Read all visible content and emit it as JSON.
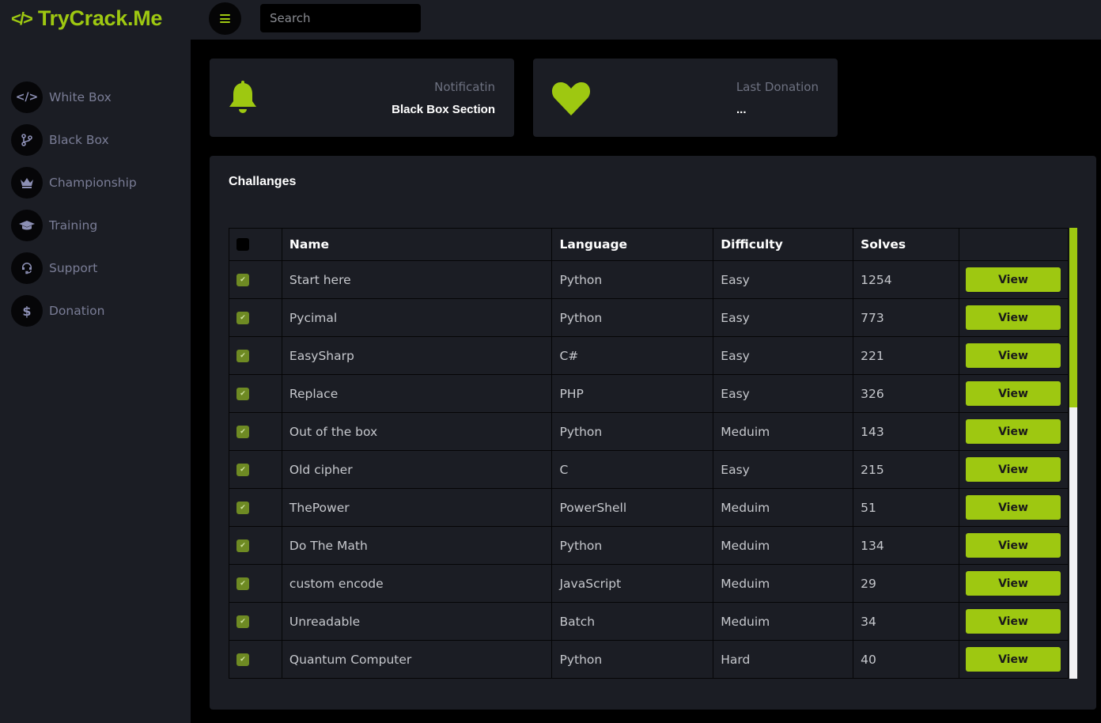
{
  "brand": {
    "name": "TryCrack.Me",
    "icon": "code-icon",
    "accent": "#9ec811"
  },
  "topbar": {
    "menu_icon": "hamburger-icon",
    "search_placeholder": "Search",
    "search_value": ""
  },
  "sidebar": {
    "items": [
      {
        "label": "White Box",
        "icon": "code-icon"
      },
      {
        "label": "Black Box",
        "icon": "code-branch-icon"
      },
      {
        "label": "Championship",
        "icon": "crown-icon"
      },
      {
        "label": "Training",
        "icon": "graduation-cap-icon"
      },
      {
        "label": "Support",
        "icon": "headset-icon"
      },
      {
        "label": "Donation",
        "icon": "dollar-icon"
      }
    ]
  },
  "cards": {
    "notification": {
      "title": "Notificatin",
      "value": "Black Box Section",
      "icon": "bell-icon"
    },
    "donation": {
      "title": "Last Donation",
      "value": "...",
      "icon": "heart-icon"
    }
  },
  "challenges": {
    "title": "Challanges",
    "columns": [
      "",
      "Name",
      "Language",
      "Difficulty",
      "Solves",
      ""
    ],
    "view_label": "View",
    "rows": [
      {
        "checked": true,
        "name": "Start here",
        "language": "Python",
        "difficulty": "Easy",
        "solves": "1254"
      },
      {
        "checked": true,
        "name": "Pycimal",
        "language": "Python",
        "difficulty": "Easy",
        "solves": "773"
      },
      {
        "checked": true,
        "name": "EasySharp",
        "language": "C#",
        "difficulty": "Easy",
        "solves": "221"
      },
      {
        "checked": true,
        "name": "Replace",
        "language": "PHP",
        "difficulty": "Easy",
        "solves": "326"
      },
      {
        "checked": true,
        "name": "Out of the box",
        "language": "Python",
        "difficulty": "Meduim",
        "solves": "143"
      },
      {
        "checked": true,
        "name": "Old cipher",
        "language": "C",
        "difficulty": "Easy",
        "solves": "215"
      },
      {
        "checked": true,
        "name": "ThePower",
        "language": "PowerShell",
        "difficulty": "Meduim",
        "solves": "51"
      },
      {
        "checked": true,
        "name": "Do The Math",
        "language": "Python",
        "difficulty": "Meduim",
        "solves": "134"
      },
      {
        "checked": true,
        "name": "custom encode",
        "language": "JavaScript",
        "difficulty": "Meduim",
        "solves": "29"
      },
      {
        "checked": true,
        "name": "Unreadable",
        "language": "Batch",
        "difficulty": "Meduim",
        "solves": "34"
      },
      {
        "checked": true,
        "name": "Quantum Computer",
        "language": "Python",
        "difficulty": "Hard",
        "solves": "40"
      }
    ]
  }
}
